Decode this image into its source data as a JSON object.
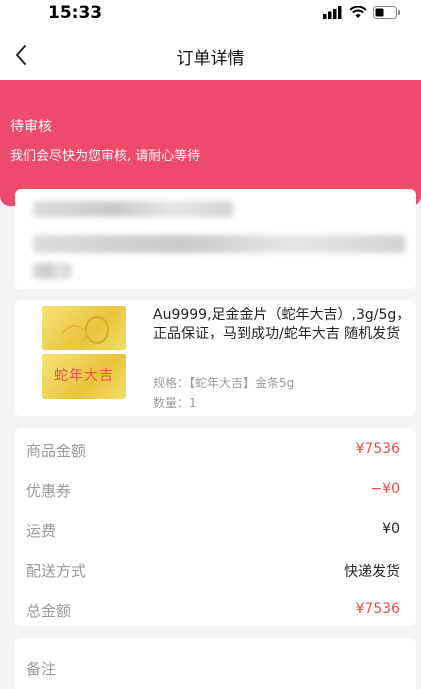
{
  "status_bar": {
    "time": "15:33"
  },
  "nav": {
    "title": "订单详情"
  },
  "banner": {
    "status": "待审核",
    "note": "我们会尽快为您审核, 请耐心等待"
  },
  "product": {
    "name": "Au9999,足金金片（蛇年大吉）,3g/5g，正品保证，马到成功/蛇年大吉 随机发货",
    "thumb_text": "蛇年大吉",
    "spec": "规格：【蛇年大吉】金条5g",
    "quantity": "数量：1"
  },
  "price": {
    "rows": [
      {
        "label": "商品金额",
        "value": "¥7536"
      },
      {
        "label": "优惠券",
        "value": "−¥0"
      },
      {
        "label": "运费",
        "value": "¥0"
      },
      {
        "label": "配送方式",
        "value": "快递发货"
      },
      {
        "label": "总金额",
        "value": "¥7536"
      }
    ]
  },
  "remark": {
    "label": "备注"
  },
  "colors": {
    "banner": "#ee4a6b",
    "price_red": "#f04747"
  }
}
